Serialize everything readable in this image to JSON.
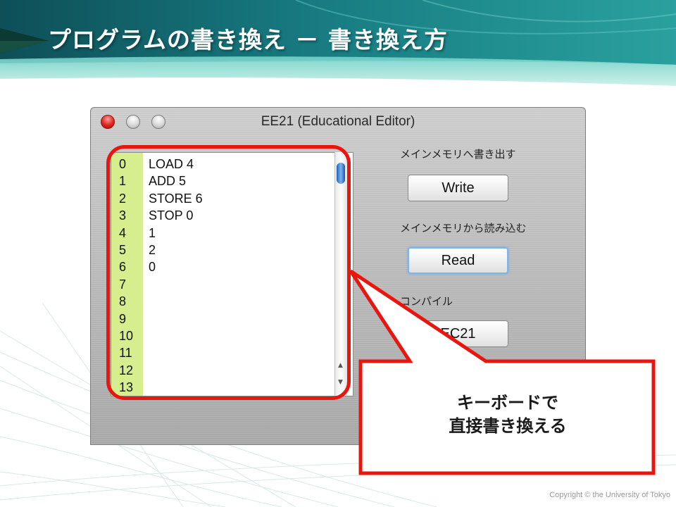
{
  "slide": {
    "title": "プログラムの書き換え － 書き換え方",
    "copyright": "Copyright © the University of Tokyo"
  },
  "window": {
    "title": "EE21 (Educational Editor)"
  },
  "code_lines": [
    {
      "num": "0",
      "text": "LOAD 4"
    },
    {
      "num": "1",
      "text": "ADD 5"
    },
    {
      "num": "2",
      "text": "STORE 6"
    },
    {
      "num": "3",
      "text": "STOP 0"
    },
    {
      "num": "4",
      "text": "1"
    },
    {
      "num": "5",
      "text": "2"
    },
    {
      "num": "6",
      "text": "0"
    },
    {
      "num": "7",
      "text": ""
    },
    {
      "num": "8",
      "text": ""
    },
    {
      "num": "9",
      "text": ""
    },
    {
      "num": "10",
      "text": ""
    },
    {
      "num": "11",
      "text": ""
    },
    {
      "num": "12",
      "text": ""
    },
    {
      "num": "13",
      "text": ""
    }
  ],
  "panel": {
    "write_label": "メインメモリへ書き出す",
    "write_button": "Write",
    "read_label": "メインメモリから読み込む",
    "read_button": "Read",
    "compile_label": "コンパイル",
    "compile_button": "EC21"
  },
  "callout": {
    "line1": "キーボードで",
    "line2": "直接書き換える"
  },
  "colors": {
    "accent_red": "#e8160e",
    "gutter": "#d7ee8e",
    "header_teal": "#1d7e80"
  }
}
